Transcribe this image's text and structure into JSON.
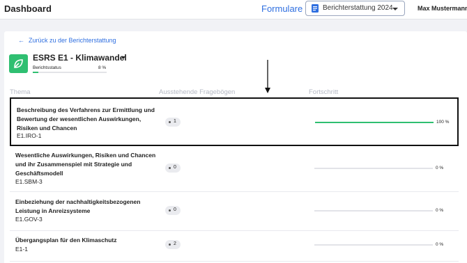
{
  "header": {
    "brand": "Dashboard",
    "nav_link": "Formulare",
    "report_select": {
      "selected": "Berichterstattung 2024",
      "icon": "document-icon"
    },
    "user_name": "Max Mustermann"
  },
  "page": {
    "back_link": "Zurück zu der Berichterstattung",
    "topic": {
      "title": "ESRS E1 - Klimawandel",
      "icon": "leaf-icon",
      "accent": "#2fbf71"
    },
    "status": {
      "label": "Berichtsstatus",
      "value_text": "8 %",
      "progress": 0.08
    }
  },
  "table": {
    "headers": [
      "Thema",
      "Ausstehende Fragebögen",
      "Fortschritt"
    ],
    "rows": [
      {
        "title_lines": [
          "Beschreibung des Verfahrens zur Ermittlung und",
          "Bewertung der wesentlichen Auswirkungen,",
          "Risiken und Chancen"
        ],
        "code": "E1.IRO-1",
        "pending": "1",
        "progress": 1.0,
        "percent_text": "100 %",
        "highlighted": true
      },
      {
        "title_lines": [
          "Wesentliche Auswirkungen, Risiken und Chancen",
          "und ihr Zusammenspiel mit Strategie und",
          "Geschäftsmodell"
        ],
        "code": "E1.SBM-3",
        "pending": "0",
        "progress": 0,
        "percent_text": "0 %",
        "highlighted": false
      },
      {
        "title_lines": [
          "Einbeziehung der nachhaltigkeitsbezogenen",
          "Leistung in Anreizsysteme"
        ],
        "code": "E1.GOV-3",
        "pending": "0",
        "progress": 0,
        "percent_text": "0 %",
        "highlighted": false
      },
      {
        "title_lines": [
          "Übergangsplan für den Klimaschutz"
        ],
        "code": "E1-1",
        "pending": "2",
        "progress": 0,
        "percent_text": "0 %",
        "highlighted": false
      }
    ]
  },
  "colors": {
    "link": "#2f6fe0",
    "progress": "#2fbf71"
  }
}
